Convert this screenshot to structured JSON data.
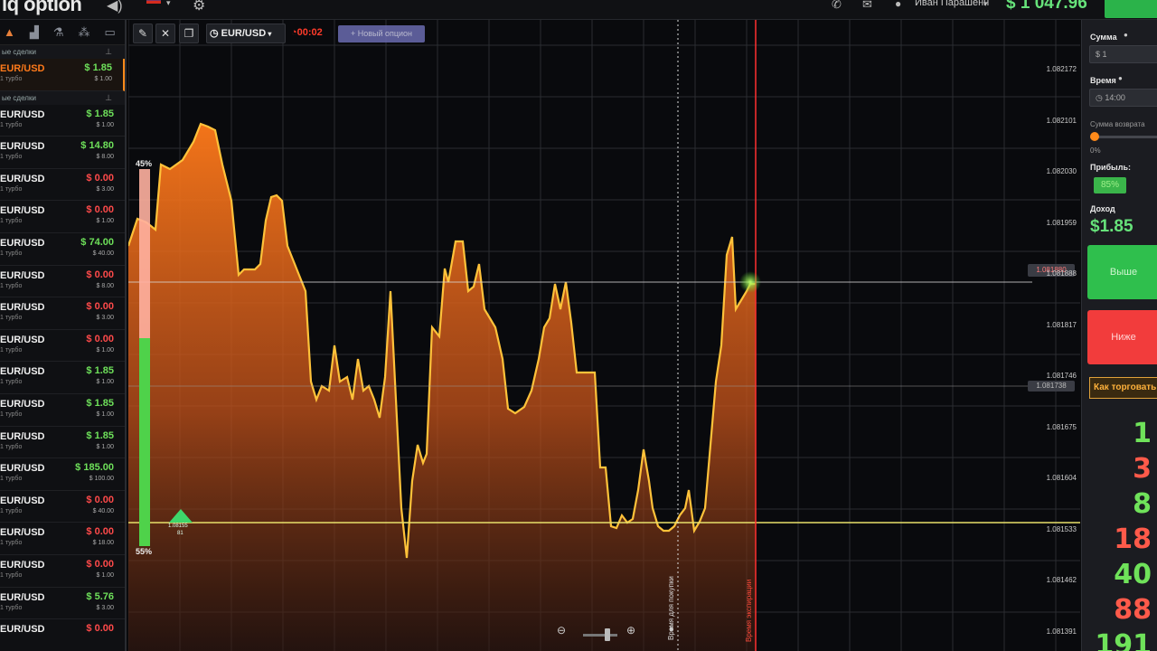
{
  "topbar": {
    "logo": "iq option",
    "user_name": "Иван Парашенн",
    "balance": "$ 1 047.96"
  },
  "sidebar": {
    "section_open": "ые сделки",
    "section_closed": "ые сделки",
    "open_trade": {
      "pair": "EUR/USD",
      "sub": "1 турбо",
      "amount": "$ 1.85",
      "stake": "$ 1.00"
    },
    "trades": [
      {
        "pair": "EUR/USD",
        "sub": "1 турбо",
        "amount": "$ 1.85",
        "stake": "$ 1.00",
        "result": "win"
      },
      {
        "pair": "EUR/USD",
        "sub": "1 турбо",
        "amount": "$ 14.80",
        "stake": "$ 8.00",
        "result": "win"
      },
      {
        "pair": "EUR/USD",
        "sub": "1 турбо",
        "amount": "$ 0.00",
        "stake": "$ 3.00",
        "result": "loss"
      },
      {
        "pair": "EUR/USD",
        "sub": "1 турбо",
        "amount": "$ 0.00",
        "stake": "$ 1.00",
        "result": "loss"
      },
      {
        "pair": "EUR/USD",
        "sub": "1 турбо",
        "amount": "$ 74.00",
        "stake": "$ 40.00",
        "result": "win"
      },
      {
        "pair": "EUR/USD",
        "sub": "1 турбо",
        "amount": "$ 0.00",
        "stake": "$ 8.00",
        "result": "loss"
      },
      {
        "pair": "EUR/USD",
        "sub": "1 турбо",
        "amount": "$ 0.00",
        "stake": "$ 3.00",
        "result": "loss"
      },
      {
        "pair": "EUR/USD",
        "sub": "1 турбо",
        "amount": "$ 0.00",
        "stake": "$ 1.00",
        "result": "loss"
      },
      {
        "pair": "EUR/USD",
        "sub": "1 турбо",
        "amount": "$ 1.85",
        "stake": "$ 1.00",
        "result": "win"
      },
      {
        "pair": "EUR/USD",
        "sub": "1 турбо",
        "amount": "$ 1.85",
        "stake": "$ 1.00",
        "result": "win"
      },
      {
        "pair": "EUR/USD",
        "sub": "1 турбо",
        "amount": "$ 1.85",
        "stake": "$ 1.00",
        "result": "win"
      },
      {
        "pair": "EUR/USD",
        "sub": "1 турбо",
        "amount": "$ 185.00",
        "stake": "$ 100.00",
        "result": "win"
      },
      {
        "pair": "EUR/USD",
        "sub": "1 турбо",
        "amount": "$ 0.00",
        "stake": "$ 40.00",
        "result": "loss"
      },
      {
        "pair": "EUR/USD",
        "sub": "1 турбо",
        "amount": "$ 0.00",
        "stake": "$ 18.00",
        "result": "loss"
      },
      {
        "pair": "EUR/USD",
        "sub": "1 турбо",
        "amount": "$ 0.00",
        "stake": "$ 1.00",
        "result": "loss"
      },
      {
        "pair": "EUR/USD",
        "sub": "1 турбо",
        "amount": "$ 5.76",
        "stake": "$ 3.00",
        "result": "win"
      },
      {
        "pair": "EUR/USD",
        "sub": "",
        "amount": "$ 0.00",
        "stake": "",
        "result": "loss"
      }
    ]
  },
  "toolbar": {
    "asset": "EUR/USD",
    "timer": "00:02",
    "new_option": "+ Новый опцион"
  },
  "chart": {
    "price_levels": [
      "1.082172",
      "1.082101",
      "1.082030",
      "1.081959",
      "1.081888",
      "1.081817",
      "1.081746",
      "1.081675",
      "1.081604",
      "1.081533",
      "1.081462",
      "1.081391"
    ],
    "current_price_tag": "1.081880",
    "entry_price_tag": "1.081738",
    "pct_up": "45%",
    "pct_down": "55%",
    "trade_marker_price": "1.08155",
    "trade_marker_id": "81",
    "purchase_time_label": "Время для покупки",
    "expiry_time_label": "Время экспирации"
  },
  "right_panel": {
    "amount_label": "Сумма",
    "amount_value": "$ 1",
    "time_label": "Время",
    "time_value": "14:00",
    "return_label": "Сумма возврата",
    "return_pct": "0%",
    "profit_label": "Прибыль:",
    "profit_value": "85%",
    "income_label": "Доход",
    "income_value": "$1.85",
    "call_label": "Выше",
    "put_label": "Ниже",
    "howto_label": "Как торговать",
    "fib_numbers": [
      "1",
      "3",
      "8",
      "18",
      "40",
      "88",
      "191"
    ]
  }
}
